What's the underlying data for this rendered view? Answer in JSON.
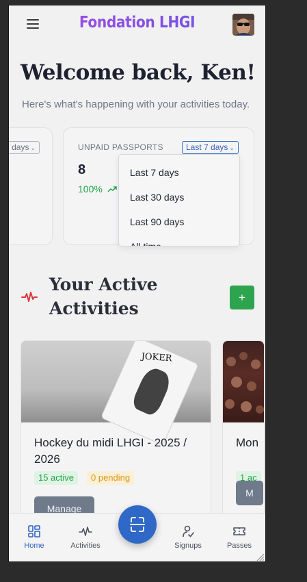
{
  "header": {
    "brand": "Fondation LHGI",
    "menu_icon": "hamburger-icon",
    "avatar_icon": "user-avatar"
  },
  "welcome": {
    "title": "Welcome back, Ken!",
    "subtitle": "Here's what's happening with your activities today."
  },
  "stats": {
    "left_card": {
      "period": "days"
    },
    "right_card": {
      "title": "UNPAID PASSPORTS",
      "period": "Last 7 days",
      "value": "8",
      "trend": "100%",
      "trend_color": "#22a448"
    },
    "dropdown": {
      "options": [
        "Last 7 days",
        "Last 30 days",
        "Last 90 days",
        "All time"
      ]
    }
  },
  "activities_section": {
    "title": "Your Active Activities",
    "add_label": "+",
    "accent": "#2ea44f",
    "icon": "activity-pulse-icon"
  },
  "activities": [
    {
      "title": "Hockey du midi LHGI - 2025 / 2026",
      "active": "15 active",
      "pending": "0 pending",
      "manage_label": "Manage"
    },
    {
      "title": "Mon",
      "active": "1 ac",
      "manage_label": "M"
    }
  ],
  "bottom_nav": {
    "items": [
      {
        "label": "Home",
        "icon": "home-grid-icon",
        "active": true
      },
      {
        "label": "Activities",
        "icon": "activity-pulse-icon"
      },
      {
        "label": "Signups",
        "icon": "user-check-icon"
      },
      {
        "label": "Passes",
        "icon": "ticket-icon"
      }
    ],
    "scan_icon": "scan-icon",
    "accent": "#2f62c4"
  }
}
